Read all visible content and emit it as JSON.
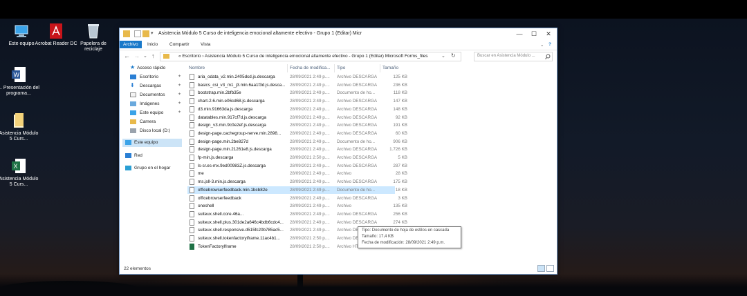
{
  "desktop": {
    "icons": [
      {
        "label": "Este equipo",
        "icon": "computer-icon"
      },
      {
        "label": "Acrobat Reader DC",
        "icon": "acrobat-icon"
      },
      {
        "label": "Papelera de reciclaje",
        "icon": "recycle-bin-icon"
      },
      {
        "label": "1. Presentación del programa...",
        "icon": "word-doc-icon"
      },
      {
        "label": "Asistencia Módulo 5 Curs...",
        "icon": "folder-icon"
      },
      {
        "label": "Asistencia Módulo 5 Curs...",
        "icon": "excel-icon"
      }
    ]
  },
  "window": {
    "title": "Asistencia Módulo 5 Curso de inteligencia emocional altamente efectivo - Grupo 1 (Editar) Micr",
    "controls": {
      "minimize": "—",
      "maximize": "☐",
      "close": "✕"
    }
  },
  "ribbon": {
    "tabs": [
      "Archivo",
      "Inicio",
      "Compartir",
      "Vista"
    ],
    "expand": "⌄",
    "help": "?"
  },
  "address": {
    "back": "←",
    "forward": "→",
    "recent": "⌄",
    "up": "↑",
    "path": "«  Escritorio  ›  Asistencia Módulo 5 Curso de inteligencia emocional altamente efectivo - Grupo 1 (Editar) Microsoft Forms_files",
    "refresh": "↻",
    "search_placeholder": "Buscar en Asistencia Módulo ..."
  },
  "nav_pane": {
    "items": [
      {
        "label": "Acceso rápido",
        "icon": "star-icon",
        "pinned": false
      },
      {
        "label": "Escritorio",
        "icon": "desktop-icon",
        "pinned": true
      },
      {
        "label": "Descargas",
        "icon": "download-icon",
        "pinned": true
      },
      {
        "label": "Documentos",
        "icon": "documents-icon",
        "pinned": true
      },
      {
        "label": "Imágenes",
        "icon": "pictures-icon",
        "pinned": true
      },
      {
        "label": "Este equipo",
        "icon": "computer-icon",
        "pinned": true
      },
      {
        "label": "Camera",
        "icon": "folder-icon",
        "pinned": false
      },
      {
        "label": "Disco local (D:)",
        "icon": "drive-icon",
        "pinned": false
      },
      {
        "label": "Este equipo",
        "icon": "computer-icon",
        "pinned": false
      },
      {
        "label": "Red",
        "icon": "network-icon",
        "pinned": false
      },
      {
        "label": "Grupo en el hogar",
        "icon": "homegroup-icon",
        "pinned": false
      }
    ],
    "pin_glyph": "📌"
  },
  "columns": {
    "name": "Nombre",
    "date": "Fecha de modifica...",
    "type": "Tipo",
    "size": "Tamaño"
  },
  "files": [
    {
      "name": "aria_odata_v2.min.2405dcd.js.descarga",
      "date": "28/09/2021 2:49 p....",
      "type": "Archivo DESCARGA",
      "size": "125 KB"
    },
    {
      "name": "basics_csi_v3_m1_j3.min.6aa1f3d.js.desca...",
      "date": "28/09/2021 2:49 p....",
      "type": "Archivo DESCARGA",
      "size": "236 KB"
    },
    {
      "name": "bootstrap.min.2bfb35e",
      "date": "28/09/2021 2:49 p....",
      "type": "Documento de ho...",
      "size": "118 KB"
    },
    {
      "name": "chart-2.6.min.e06cd68.js.descarga",
      "date": "28/09/2021 2:49 p....",
      "type": "Archivo DESCARGA",
      "size": "147 KB"
    },
    {
      "name": "d3.min.91663da.js.descarga",
      "date": "28/09/2021 2:49 p....",
      "type": "Archivo DESCARGA",
      "size": "148 KB"
    },
    {
      "name": "datatables.min.917cf7d.js.descarga",
      "date": "28/09/2021 2:49 p....",
      "type": "Archivo DESCARGA",
      "size": "92 KB"
    },
    {
      "name": "design_v3.min.9c0e2ef.js.descarga",
      "date": "28/09/2021 2:49 p....",
      "type": "Archivo DESCARGA",
      "size": "191 KB"
    },
    {
      "name": "design-page.cachegroup-nerve.min.2898...",
      "date": "28/09/2021 2:49 p....",
      "type": "Archivo DESCARGA",
      "size": "60 KB"
    },
    {
      "name": "design-page.min.2be827d",
      "date": "28/09/2021 2:49 p....",
      "type": "Documento de ho...",
      "size": "906 KB"
    },
    {
      "name": "design-page.min.21261e8.js.descarga",
      "date": "28/09/2021 2:49 p....",
      "type": "Archivo DESCARGA",
      "size": "1.726 KB"
    },
    {
      "name": "fp-min.js.descarga",
      "date": "28/09/2021 2:50 p....",
      "type": "Archivo DESCARGA",
      "size": "5 KB"
    },
    {
      "name": "ls-sr.es-mx.9ed00983Z.js.descarga",
      "date": "28/09/2021 2:49 p....",
      "type": "Archivo DESCARGA",
      "size": "287 KB"
    },
    {
      "name": "me",
      "date": "28/09/2021 2:49 p....",
      "type": "Archivo",
      "size": "28 KB"
    },
    {
      "name": "ms.jsll-3.min.js.descarga",
      "date": "28/09/2021 2:49 p....",
      "type": "Archivo DESCARGA",
      "size": "175 KB"
    },
    {
      "name": "officebrowserfeedback.min.1bcb82e",
      "date": "28/09/2021 2:49 p....",
      "type": "Documento de ho...",
      "size": "18 KB"
    },
    {
      "name": "officebrowserfeedback",
      "date": "28/09/2021 2:49 p....",
      "type": "Archivo DESCARGA",
      "size": "3 KB"
    },
    {
      "name": "oneshell",
      "date": "28/09/2021 2:49 p....",
      "type": "Archivo",
      "size": "135 KB"
    },
    {
      "name": "suiteux.shell.core.46a...",
      "date": "28/09/2021 2:49 p....",
      "type": "Archivo DESCARGA",
      "size": "256 KB"
    },
    {
      "name": "suiteux.shell.plus.301de2a646c4bdb6cdc4...",
      "date": "28/09/2021 2:49 p....",
      "type": "Archivo DESCARGA",
      "size": "274 KB"
    },
    {
      "name": "suiteux.shell.responsive.d515fc20b785ac5...",
      "date": "28/09/2021 2:49 p....",
      "type": "Archivo DESCARGA",
      "size": "52 KB"
    },
    {
      "name": "suiteux.shell.tokenfactoryiframe.11ac4b1...",
      "date": "28/09/2021 2:50 p....",
      "type": "Archivo DESCARGA",
      "size": "143 KB"
    },
    {
      "name": "TokenFactoryIframe",
      "date": "28/09/2021 2:50 p....",
      "type": "Archivo HTML",
      "size": "3 KB"
    }
  ],
  "selected_index": 14,
  "tooltip": {
    "type_line": "Tipo: Documento de hoja de estilos en cascada",
    "size_line": "Tamaño: 17,4 KB",
    "date_line": "Fecha de modificación: 28/09/2021 2:49 p.m."
  },
  "status": {
    "count": "22 elementos"
  },
  "colors": {
    "accent": "#1979ca",
    "selection": "#cce8ff",
    "folder": "#e8b94a"
  }
}
